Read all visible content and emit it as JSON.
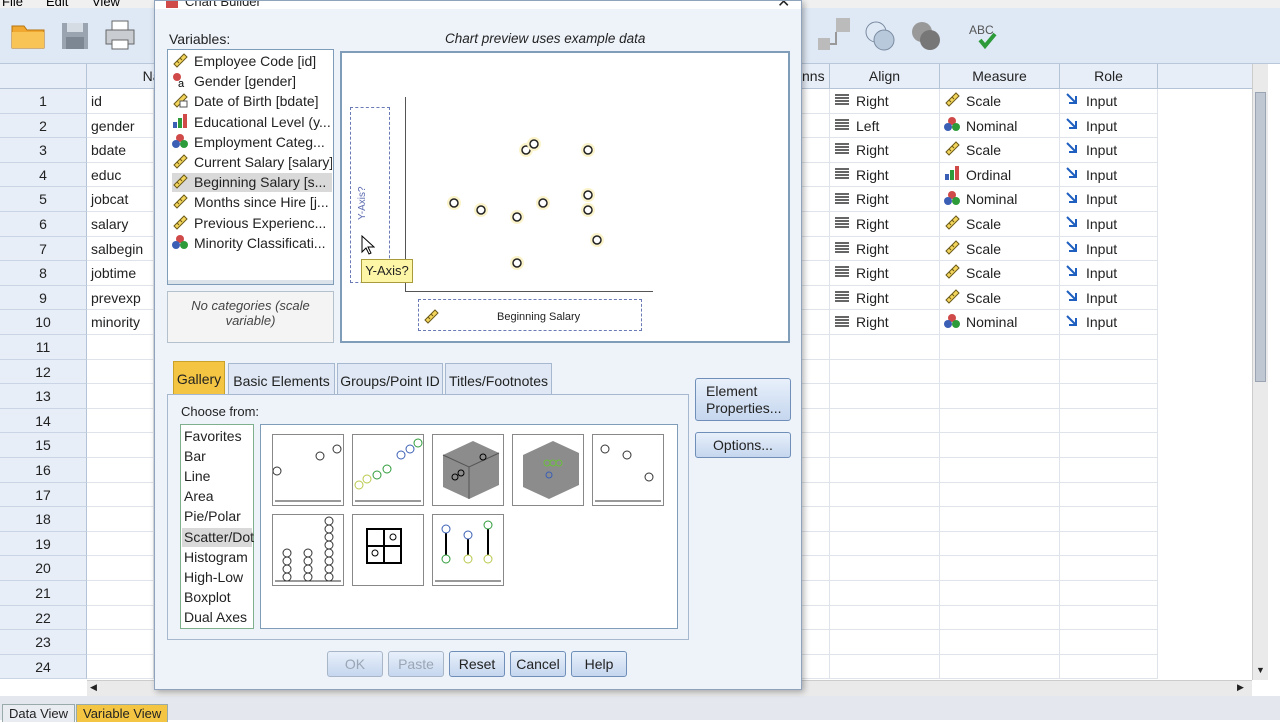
{
  "menu": [
    "File",
    "Edit",
    "View"
  ],
  "dialog": {
    "title": "Chart Builder",
    "variables_label": "Variables:",
    "preview_label": "Chart preview uses example data",
    "variables": [
      {
        "label": "Employee Code [id]",
        "icon": "scale-ruler-icon"
      },
      {
        "label": "Gender [gender]",
        "icon": "nominal-text-icon"
      },
      {
        "label": "Date of Birth [bdate]",
        "icon": "date-ruler-icon"
      },
      {
        "label": "Educational Level (y...",
        "icon": "ordinal-bar-icon"
      },
      {
        "label": "Employment Categ...",
        "icon": "nominal-balls-icon"
      },
      {
        "label": "Current Salary [salary]",
        "icon": "scale-ruler-icon"
      },
      {
        "label": "Beginning Salary [s...",
        "icon": "scale-ruler-icon",
        "selected": true
      },
      {
        "label": "Months since Hire [j...",
        "icon": "scale-ruler-icon"
      },
      {
        "label": "Previous Experienc...",
        "icon": "scale-ruler-icon"
      },
      {
        "label": "Minority Classificati...",
        "icon": "nominal-balls-icon"
      }
    ],
    "no_categories": "No categories (scale variable)",
    "y_axis_drop": "Y-Axis?",
    "y_axis_tooltip": "Y-Axis?",
    "x_axis_variable": "Beginning Salary",
    "tabs": [
      "Gallery",
      "Basic Elements",
      "Groups/Point ID",
      "Titles/Footnotes"
    ],
    "active_tab": "Gallery",
    "choose_from_label": "Choose from:",
    "chart_types": [
      "Favorites",
      "Bar",
      "Line",
      "Area",
      "Pie/Polar",
      "Scatter/Dot",
      "Histogram",
      "High-Low",
      "Boxplot",
      "Dual Axes"
    ],
    "selected_type": "Scatter/Dot",
    "side_buttons": {
      "element_properties": "Element Properties...",
      "options": "Options..."
    },
    "buttons": {
      "ok": "OK",
      "paste": "Paste",
      "reset": "Reset",
      "cancel": "Cancel",
      "help": "Help"
    }
  },
  "grid": {
    "columns": {
      "name": "Name",
      "columns": "nns",
      "align": "Align",
      "measure": "Measure",
      "role": "Role"
    },
    "rows": [
      {
        "num": "1",
        "name": "id",
        "align": "Right",
        "measure": "Scale",
        "role": "Input"
      },
      {
        "num": "2",
        "name": "gender",
        "align": "Left",
        "measure": "Nominal",
        "role": "Input"
      },
      {
        "num": "3",
        "name": "bdate",
        "align": "Right",
        "measure": "Scale",
        "role": "Input"
      },
      {
        "num": "4",
        "name": "educ",
        "align": "Right",
        "measure": "Ordinal",
        "role": "Input"
      },
      {
        "num": "5",
        "name": "jobcat",
        "align": "Right",
        "measure": "Nominal",
        "role": "Input"
      },
      {
        "num": "6",
        "name": "salary",
        "align": "Right",
        "measure": "Scale",
        "role": "Input"
      },
      {
        "num": "7",
        "name": "salbegin",
        "align": "Right",
        "measure": "Scale",
        "role": "Input"
      },
      {
        "num": "8",
        "name": "jobtime",
        "align": "Right",
        "measure": "Scale",
        "role": "Input"
      },
      {
        "num": "9",
        "name": "prevexp",
        "align": "Right",
        "measure": "Scale",
        "role": "Input"
      },
      {
        "num": "10",
        "name": "minority",
        "align": "Right",
        "measure": "Nominal",
        "role": "Input"
      }
    ],
    "empty_rows": [
      "11",
      "12",
      "13",
      "14",
      "15",
      "16",
      "17",
      "18",
      "19",
      "20",
      "21",
      "22",
      "23",
      "24"
    ]
  },
  "bottom_tabs": [
    "Data View",
    "Variable View"
  ],
  "active_bottom_tab": "Variable View",
  "colors": {
    "accent": "#f4c542",
    "grid_header": "#e7eef8",
    "dialog_bg": "#eef3fa"
  }
}
